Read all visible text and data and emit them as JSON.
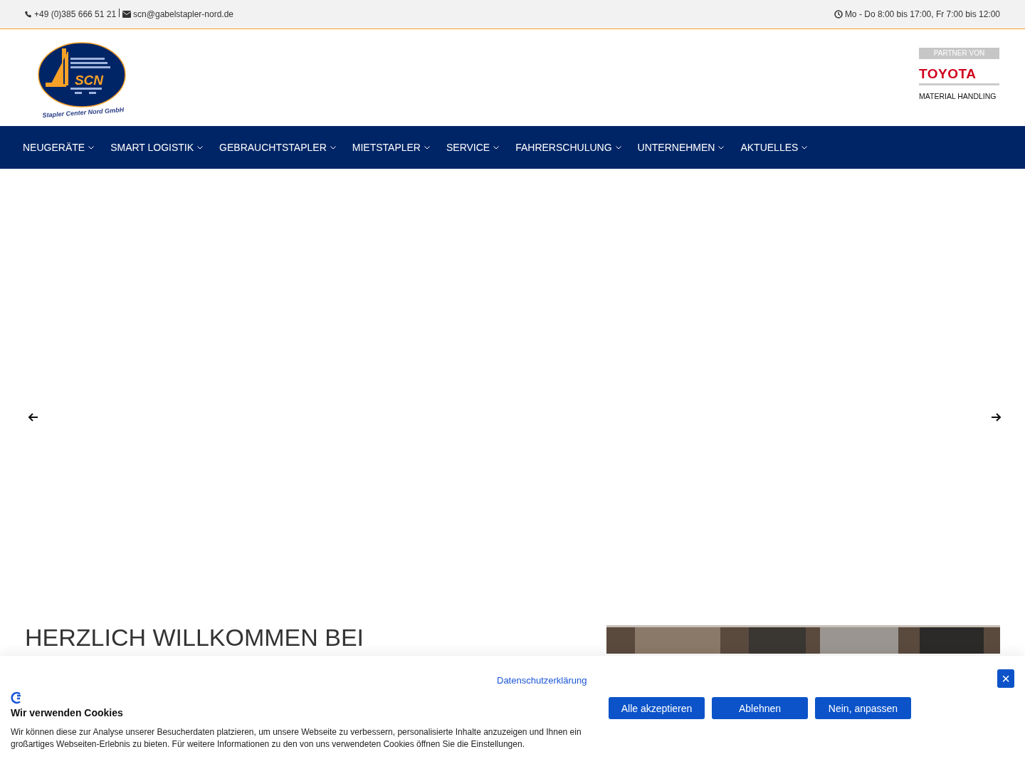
{
  "topbar": {
    "phone": "+49 (0)385 666 51 21",
    "email": "scn@gabelstapler-nord.de",
    "hours": "Mo - Do 8:00 bis 17:00, Fr 7:00 bis 12:00"
  },
  "logo": {
    "mark": "SCN",
    "subtitle": "Stapler Center Nord GmbH"
  },
  "partner": {
    "label": "PARTNER VON",
    "brand": "TOYOTA",
    "tagline": "MATERIAL HANDLING"
  },
  "nav": [
    {
      "label": "NEUGERÄTE"
    },
    {
      "label": "SMART LOGISTIK"
    },
    {
      "label": "GEBRAUCHTSTAPLER"
    },
    {
      "label": "MIETSTAPLER"
    },
    {
      "label": "SERVICE"
    },
    {
      "label": "FAHRERSCHULUNG"
    },
    {
      "label": "UNTERNEHMEN"
    },
    {
      "label": "AKTUELLES"
    }
  ],
  "welcome": {
    "heading": "HERZLICH WILLKOMMEN BEI"
  },
  "cookie_banner": {
    "title": "Wir verwenden Cookies",
    "text": "Wir können diese zur Analyse unserer Besucherdaten platzieren, um unsere Webseite zu verbessern, personalisierte Inhalte anzuzeigen und Ihnen ein großartiges Webseiten-Erlebnis zu bieten. Für weitere Informationen zu den von uns verwendeten Cookies öffnen Sie die Einstellungen.",
    "privacy_link": "Datenschutzerklärung",
    "buttons": [
      "Alle akzeptieren",
      "Ablehnen",
      "Nein, anpassen"
    ],
    "close": "×"
  }
}
